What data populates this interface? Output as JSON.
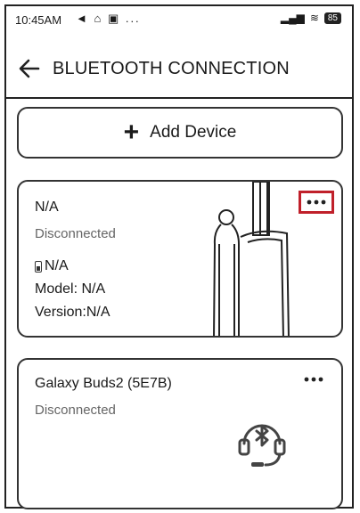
{
  "status_bar": {
    "time": "10:45AM",
    "left_icons": "◄ ⌂ ▣ ...",
    "signal": "▂▄▆",
    "wifi": "≋",
    "battery": "85"
  },
  "header": {
    "title": "BLUETOOTH CONNECTION"
  },
  "add_device": {
    "label": "Add Device"
  },
  "devices": [
    {
      "name": "N/A",
      "status": "Disconnected",
      "battery": "N/A",
      "model": "Model: N/A",
      "version": "Version:N/A",
      "icon": "radio-device-icon"
    },
    {
      "name": "Galaxy Buds2 (5E7B)",
      "status": "Disconnected",
      "icon": "bluetooth-headset-icon"
    }
  ],
  "colors": {
    "highlight": "#c0202a",
    "border": "#222222",
    "muted_text": "#666666"
  }
}
